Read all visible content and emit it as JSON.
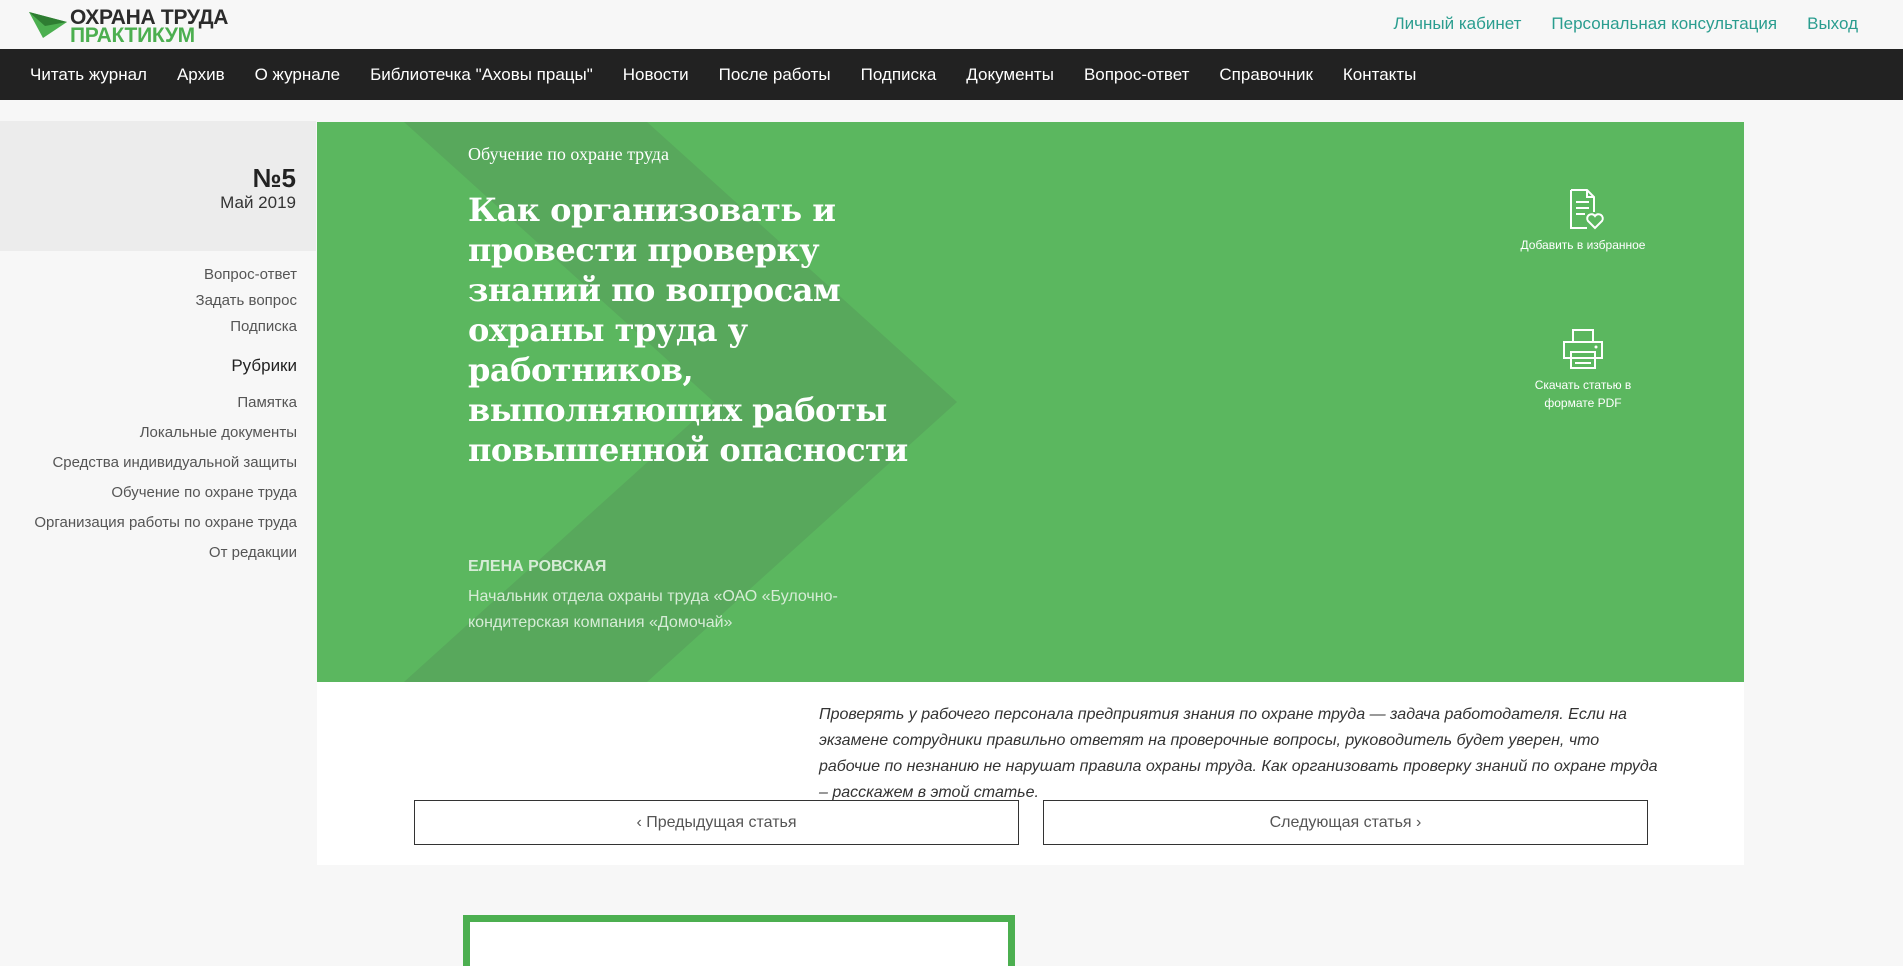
{
  "logo": {
    "line1": "ОХРАНА ТРУДА",
    "line2": "ПРАКТИКУМ",
    "icon": "paper-plane-logo-icon"
  },
  "top_links": [
    "Личный кабинет",
    "Персональная консультация",
    "Выход"
  ],
  "nav": [
    "Читать журнал",
    "Архив",
    "О журнале",
    "Библиотечка \"Аховы працы\"",
    "Новости",
    "После работы",
    "Подписка",
    "Документы",
    "Вопрос-ответ",
    "Справочник",
    "Контакты"
  ],
  "issue": {
    "number": "№5",
    "date": "Май 2019"
  },
  "sidebar": {
    "links": [
      "Вопрос-ответ",
      "Задать вопрос",
      "Подписка"
    ],
    "rubrics_heading": "Рубрики",
    "rubrics": [
      "Памятка",
      "Локальные документы",
      "Средства индивидуальной защиты",
      "Обучение по охране труда",
      "Организация работы по охране труда",
      "От редакции"
    ]
  },
  "hero": {
    "category": "Обучение по охране труда",
    "title": "Как организовать и провести проверку знаний по вопросам охраны труда у работников, выполняющих работы повышенной опасности",
    "author": "ЕЛЕНА РОВСКАЯ",
    "author_role": "Начальник отдела охраны труда «ОАО «Булочно-кондитерская компания «Домочай»",
    "actions": {
      "favorite": {
        "label": "Добавить в избранное",
        "icon": "document-heart-icon"
      },
      "pdf": {
        "label": "Скачать статью в формате PDF",
        "icon": "printer-icon"
      }
    }
  },
  "article": {
    "lead": "Проверять у рабочего персонала предприятия знания по охране труда — задача работодателя. Если на экзамене сотрудники правильно ответят на проверочные вопросы, руководитель будет уверен, что рабочие по незнанию не нарушат правила охраны труда. Как организовать проверку знаний по охране труда – расскажем в этой статье.",
    "prev_label": "‹ Предыдущая статья",
    "next_label": "Следующая статья ›"
  },
  "colors": {
    "accent_green": "#5bb75f",
    "logo_green": "#4caf50",
    "link_teal": "#2a9d8f",
    "nav_bg": "#222222"
  }
}
